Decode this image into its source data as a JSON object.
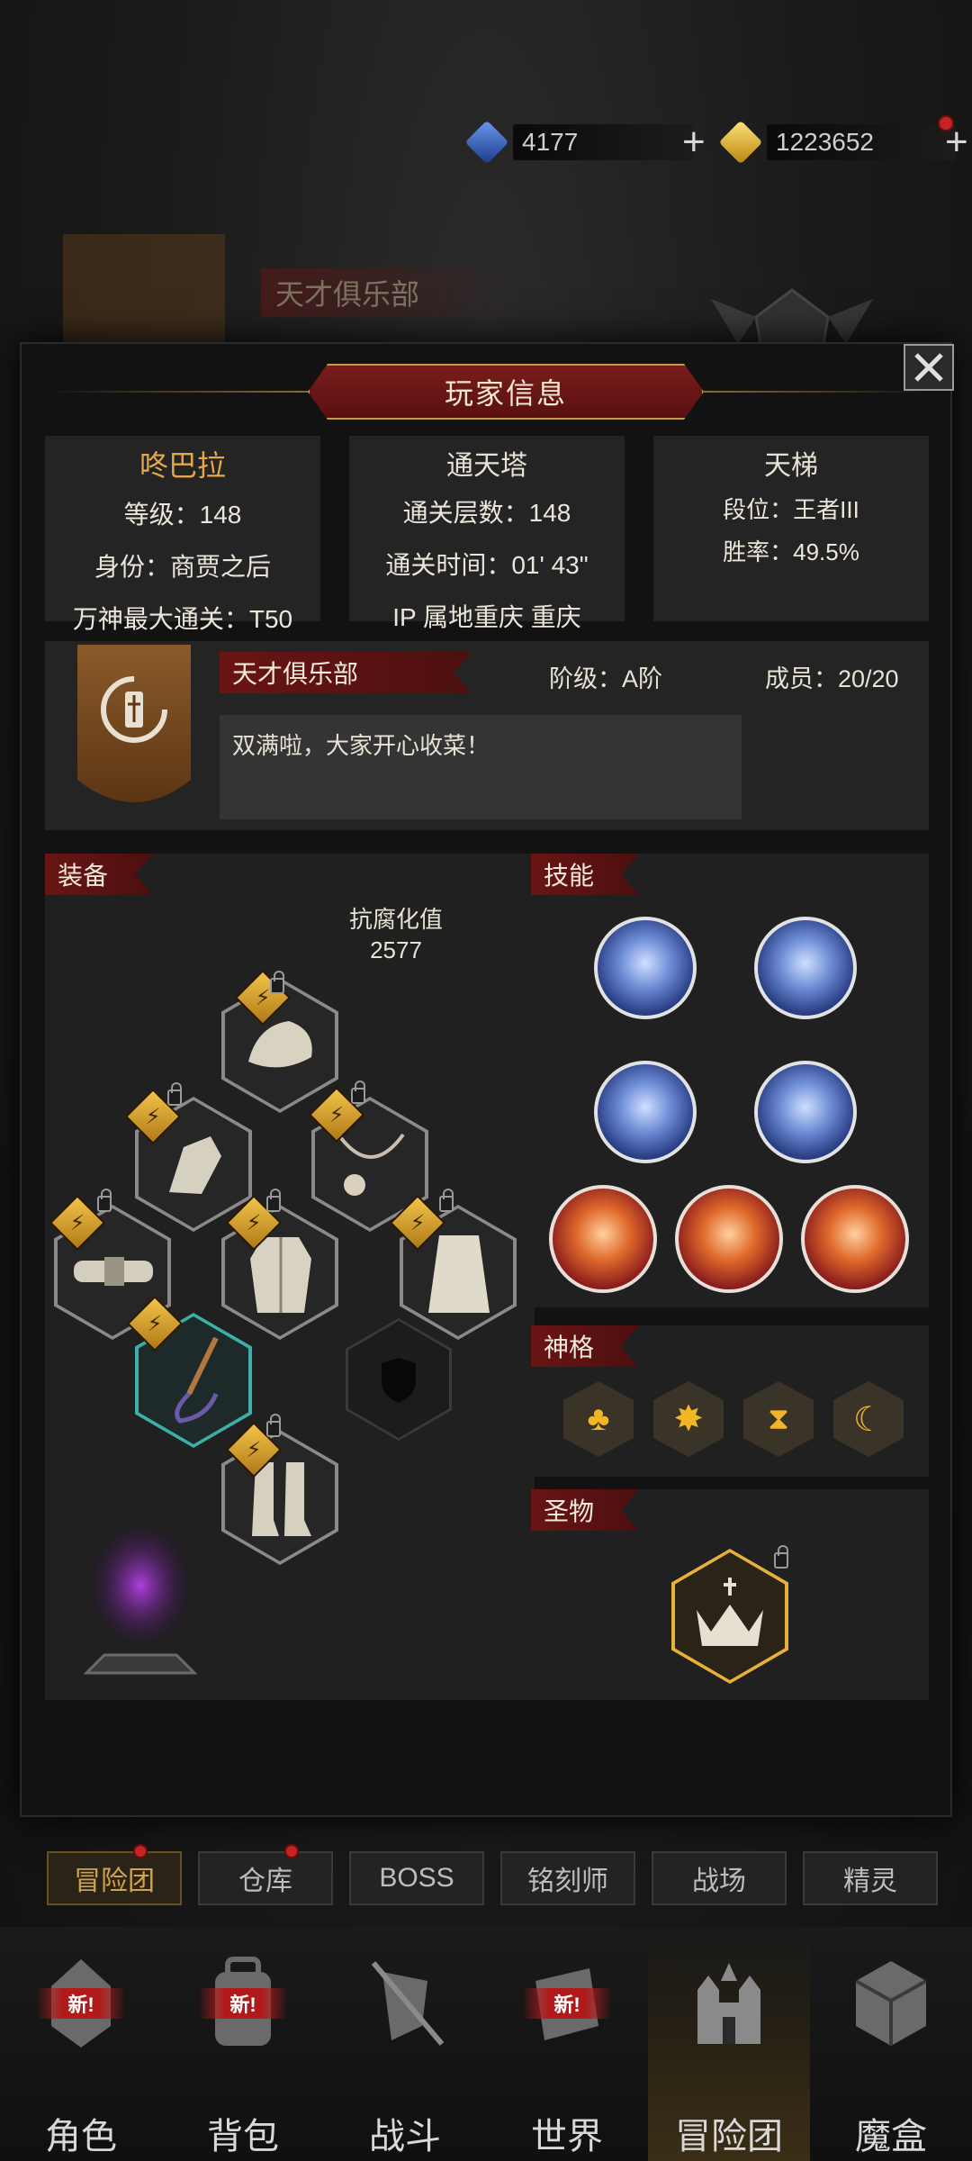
{
  "currencies": [
    {
      "name": "blue-gem",
      "amount": "4177",
      "color": "#2f5fc8"
    },
    {
      "name": "gold-gem",
      "amount": "1223652",
      "color": "#e2b52a"
    }
  ],
  "background": {
    "guild_name": "天才俱乐部"
  },
  "modal": {
    "title": "玩家信息",
    "close_icon": "close-icon",
    "player": {
      "name": "咚巴拉",
      "level": "等级：148",
      "identity": "身份：商贾之后",
      "pantheon_max": "万神最大通关：T50"
    },
    "tower": {
      "title": "通天塔",
      "floors": "通关层数：148",
      "time": "通关时间：01' 43\"",
      "ip": "IP 属地重庆 重庆"
    },
    "ladder": {
      "title": "天梯",
      "rank": "段位：王者III",
      "winrate": "胜率：49.5%"
    },
    "guild": {
      "name": "天才俱乐部",
      "tier": "阶级：A阶",
      "members": "成员：20/20",
      "motto": "双满啦，大家开心收菜！"
    },
    "equipment": {
      "title": "装备",
      "resist_label": "抗腐化值",
      "resist_value": "2577"
    },
    "skills": {
      "title": "技能"
    },
    "divinity": {
      "title": "神格"
    },
    "relic": {
      "title": "圣物"
    }
  },
  "tabs": [
    {
      "label": "冒险团",
      "active": true,
      "dot": true
    },
    {
      "label": "仓库",
      "active": false,
      "dot": true
    },
    {
      "label": "BOSS",
      "active": false,
      "dot": false
    },
    {
      "label": "铭刻师",
      "active": false,
      "dot": false
    },
    {
      "label": "战场",
      "active": false,
      "dot": false
    },
    {
      "label": "精灵",
      "active": false,
      "dot": false
    }
  ],
  "nav": [
    {
      "label": "角色",
      "icon": "helmet-icon",
      "new": "新!"
    },
    {
      "label": "背包",
      "icon": "backpack-icon",
      "new": "新!"
    },
    {
      "label": "战斗",
      "icon": "swords-shield-icon",
      "new": ""
    },
    {
      "label": "世界",
      "icon": "scroll-map-icon",
      "new": "新!"
    },
    {
      "label": "冒险团",
      "icon": "castle-icon",
      "new": ""
    },
    {
      "label": "魔盒",
      "icon": "cube-icon",
      "new": ""
    }
  ]
}
